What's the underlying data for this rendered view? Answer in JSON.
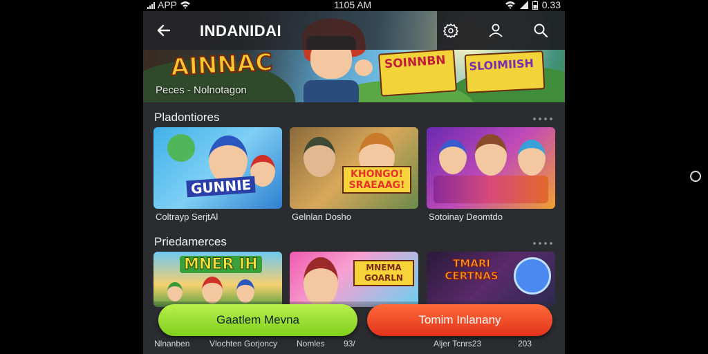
{
  "status_bar": {
    "carrier": "APP",
    "time": "1105 AM",
    "battery": "0.33"
  },
  "header": {
    "title": "INDANIDAI"
  },
  "hero": {
    "caption": "Peces - Nolnotagon",
    "art_text_1": "AINNAC",
    "art_text_2": "SOINNBN",
    "art_text_3": "SLOIMIISH"
  },
  "sections": [
    {
      "title": "Pladontiores",
      "cards": [
        {
          "label": "Coltrayp SerjtAl",
          "art_text": "GUNNIE"
        },
        {
          "label": "Gelnlan Dosho",
          "art_text": "KHONGO! SRAEAAG!"
        },
        {
          "label": "Sotoinay Deomtdo",
          "art_text": ""
        }
      ]
    },
    {
      "title": "Priedamerces",
      "cards": [
        {
          "label": "Nlnanben",
          "art_text": "MNER IH"
        },
        {
          "label": "Vlochten Gorjoncy",
          "art_text": "MNEMA GOARLN"
        },
        {
          "label": "Nomles",
          "art_text": "TMARI CERTNAS"
        }
      ]
    }
  ],
  "buttons": {
    "primary": "Gaatlem Mevna",
    "secondary": "Tomim Inlanany"
  },
  "bottom_labels": [
    "Nlnanben",
    "Vlochten Gorjoncy",
    "Nomles",
    "93/",
    "Aljer Tcnrs23",
    "203"
  ],
  "colors": {
    "app_bg": "#2b2c30",
    "green": "#9ee232",
    "red": "#f04a24"
  },
  "icons": [
    "back-arrow-icon",
    "gear-icon",
    "user-icon",
    "search-icon",
    "wifi-icon",
    "signal-icon",
    "battery-icon"
  ]
}
